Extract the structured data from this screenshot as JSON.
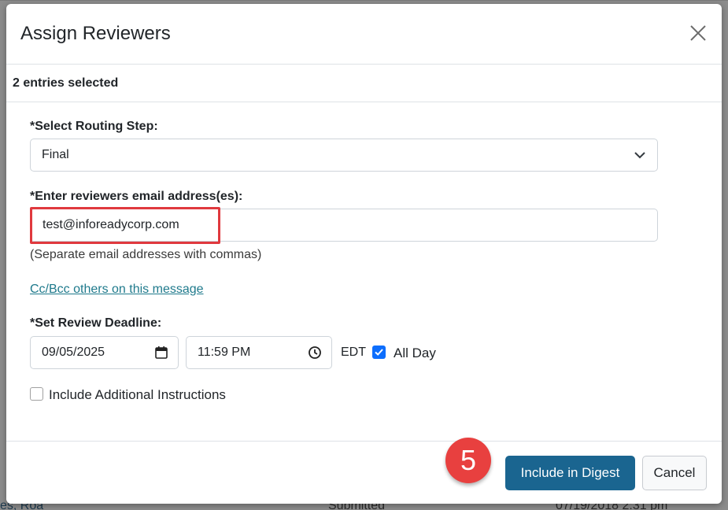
{
  "background": {
    "frag_status": "Submitted",
    "frag_date": "07/19/2018 2:31 pm",
    "frag_name": "es, Roa"
  },
  "modal": {
    "title": "Assign Reviewers",
    "selected_text": "2 entries selected",
    "routing": {
      "label": "*Select Routing Step:",
      "value": "Final"
    },
    "email": {
      "label": "*Enter reviewers email address(es):",
      "value": "test@inforeadycorp.com",
      "hint": "(Separate email addresses with commas)"
    },
    "cc_link": "Cc/Bcc others on this message",
    "deadline": {
      "label": "*Set Review Deadline:",
      "date": "09/05/2025",
      "time": "11:59 PM",
      "timezone": "EDT",
      "all_day_label": "All Day",
      "all_day_checked": true
    },
    "additional_instructions_label": "Include Additional Instructions",
    "step_badge": "5",
    "primary_button": "Include in Digest",
    "cancel_button": "Cancel"
  },
  "colors": {
    "primary": "#1a6590",
    "highlight": "#e0393e",
    "badge": "#e8403f",
    "link": "#1f7a8c"
  }
}
